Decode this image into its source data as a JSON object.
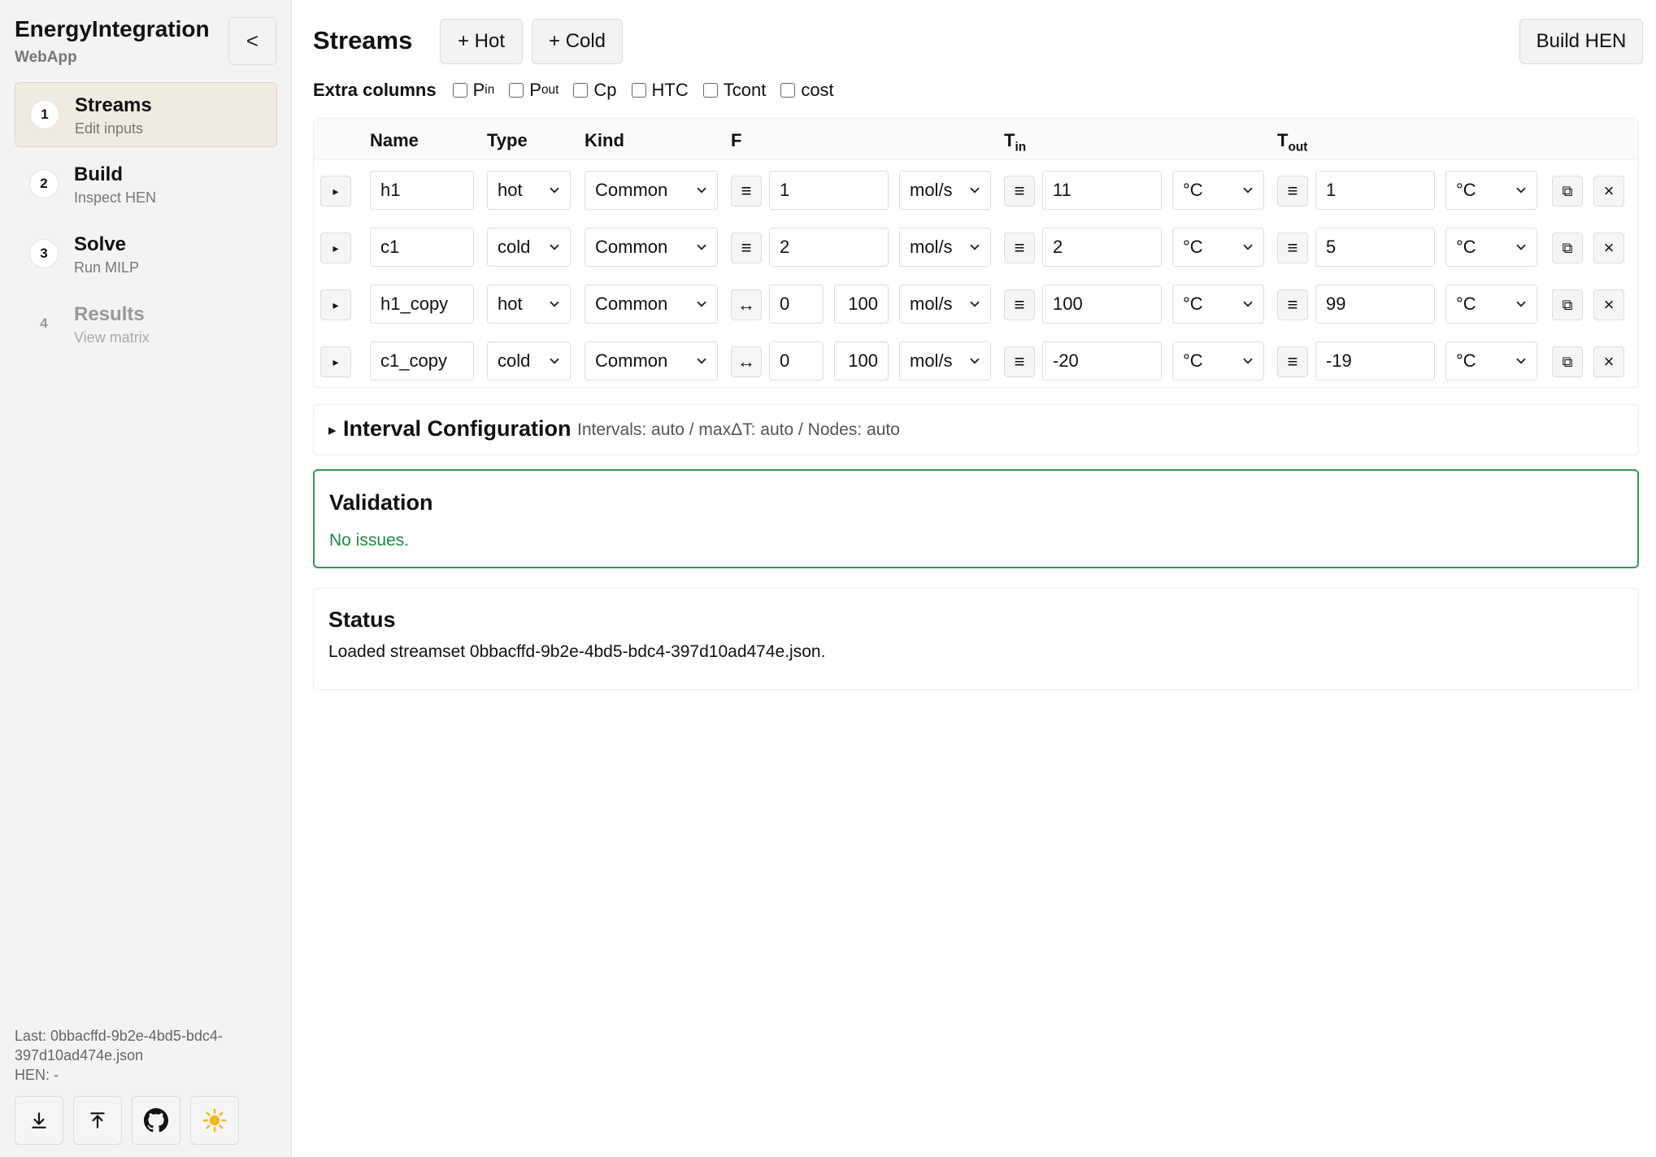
{
  "sidebar": {
    "title": "EnergyIntegration",
    "subtitle": "WebApp",
    "collapse_label": "<",
    "nav": [
      {
        "num": "1",
        "title": "Streams",
        "sub": "Edit inputs"
      },
      {
        "num": "2",
        "title": "Build",
        "sub": "Inspect HEN"
      },
      {
        "num": "3",
        "title": "Solve",
        "sub": "Run MILP"
      },
      {
        "num": "4",
        "title": "Results",
        "sub": "View matrix"
      }
    ],
    "last_text": "Last: 0bbacffd-9b2e-4bd5-bdc4-397d10ad474e.json",
    "hen_text": "HEN: -"
  },
  "header": {
    "title": "Streams",
    "add_hot": "+ Hot",
    "add_cold": "+ Cold",
    "build": "Build HEN"
  },
  "extra_columns": {
    "label": "Extra columns",
    "items": [
      {
        "main": "P",
        "sub": "in"
      },
      {
        "main": "P",
        "sub": "out"
      },
      {
        "main": "Cp",
        "sub": ""
      },
      {
        "main": "HTC",
        "sub": ""
      },
      {
        "main": "Tcont",
        "sub": ""
      },
      {
        "main": "cost",
        "sub": ""
      }
    ]
  },
  "table": {
    "headers": {
      "name": "Name",
      "type": "Type",
      "kind": "Kind",
      "f": "F",
      "tin_main": "T",
      "tin_sub": "in",
      "tout_main": "T",
      "tout_sub": "out"
    },
    "rows": [
      {
        "name": "h1",
        "type": "hot",
        "kind": "Common",
        "f_mode": "≡",
        "f1": "1",
        "f2": "",
        "f_unit": "mol/s",
        "tin_mode": "≡",
        "tin": "11",
        "tin_unit": "°C",
        "tout_mode": "≡",
        "tout": "1",
        "tout_unit": "°C"
      },
      {
        "name": "c1",
        "type": "cold",
        "kind": "Common",
        "f_mode": "≡",
        "f1": "2",
        "f2": "",
        "f_unit": "mol/s",
        "tin_mode": "≡",
        "tin": "2",
        "tin_unit": "°C",
        "tout_mode": "≡",
        "tout": "5",
        "tout_unit": "°C"
      },
      {
        "name": "h1_copy",
        "type": "hot",
        "kind": "Common",
        "f_mode": "↔",
        "f1": "0",
        "f2": "100",
        "f_unit": "mol/s",
        "tin_mode": "≡",
        "tin": "100",
        "tin_unit": "°C",
        "tout_mode": "≡",
        "tout": "99",
        "tout_unit": "°C"
      },
      {
        "name": "c1_copy",
        "type": "cold",
        "kind": "Common",
        "f_mode": "↔",
        "f1": "0",
        "f2": "100",
        "f_unit": "mol/s",
        "tin_mode": "≡",
        "tin": "-20",
        "tin_unit": "°C",
        "tout_mode": "≡",
        "tout": "-19",
        "tout_unit": "°C"
      }
    ],
    "expand_glyph": "▸",
    "duplicate_glyph": "⧉",
    "remove_glyph": "×"
  },
  "interval": {
    "arrow": "▸",
    "title": "Interval Configuration",
    "summary": "Intervals: auto / maxΔT: auto / Nodes: auto"
  },
  "validation": {
    "title": "Validation",
    "message": "No issues."
  },
  "status": {
    "title": "Status",
    "message": "Loaded streamset 0bbacffd-9b2e-4bd5-bdc4-397d10ad474e.json."
  },
  "colors": {
    "validation_border": "#2e9a52",
    "validation_text": "#1e8a3e",
    "active_nav_bg": "#f0ebe1"
  }
}
